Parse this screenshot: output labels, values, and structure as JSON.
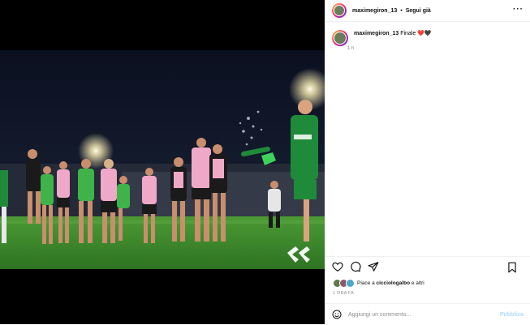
{
  "header": {
    "username": "maximegiron_13",
    "separator": "•",
    "follow_label": "Segui già",
    "more_label": "···"
  },
  "caption": {
    "username": "maximegiron_13",
    "text": "Finale ❤️🖤",
    "time": "1 h"
  },
  "actions": {
    "like_icon": "heart-icon",
    "comment_icon": "comment-icon",
    "share_icon": "share-icon",
    "save_icon": "bookmark-icon"
  },
  "likes": {
    "prefix": "Piace a ",
    "user": "cicciologalbo",
    "suffix": " e altri"
  },
  "date": "1 ORA FA",
  "comment": {
    "placeholder": "Aggiungi un commento...",
    "publish_label": "Pubblica"
  },
  "colors": {
    "pink": "#f0a8c8",
    "kit_black": "#1a1a1a",
    "keeper_green": "#1f8a3a",
    "pitch": "#3f8f2e",
    "publish": "#b3dbff"
  }
}
